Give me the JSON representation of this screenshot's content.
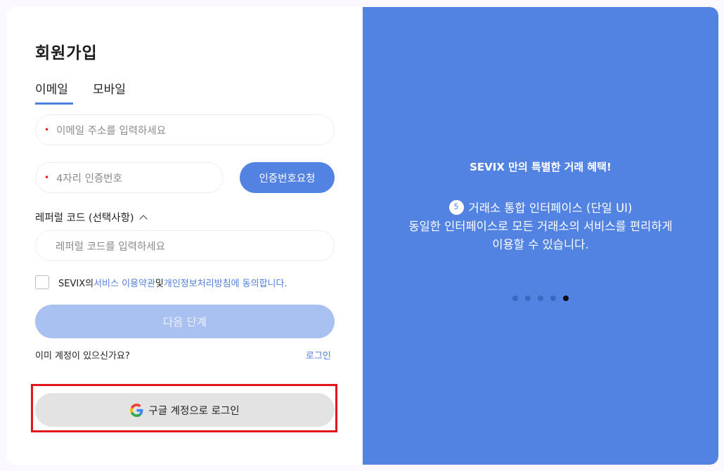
{
  "signup": {
    "title": "회원가입",
    "tabs": [
      "이메일",
      "모바일"
    ],
    "email_placeholder": "이메일 주소를 입력하세요",
    "code_placeholder": "4자리 인증번호",
    "verify_button": "인증번호요청",
    "referral_label": "레퍼럴 코드 (선택사항)",
    "referral_placeholder": "레퍼럴 코드를 입력하세요",
    "agree": {
      "prefix": "SEVIX의",
      "terms_link": "서비스 이용약관",
      "and": "및",
      "privacy_link": "개인정보처리방침",
      "suffix": "에 동의합니다."
    },
    "next_button": "다음 단계",
    "account_question": "이미 계정이 있으신가요?",
    "login_link": "로그인",
    "google_button": "구글 계정으로 로그인",
    "required_marker": "•"
  },
  "promo": {
    "title": "SEVIX 만의 특별한 거래 혜택!",
    "badge_number": "5",
    "headline": "거래소 통합 인터페이스 (단일 UI)",
    "desc_line1": "동일한 인터페이스로 모든 거래소의 서비스를 편리하게",
    "desc_line2": "이용할 수 있습니다.",
    "slide_count": 5,
    "active_slide": 5
  },
  "colors": {
    "accent": "#5383e2",
    "link": "#4f7fde",
    "required": "#e02020",
    "highlight_box": "#e0161e"
  },
  "icons": {
    "google": "google-icon",
    "referral_toggle": "chevron-up-icon"
  }
}
